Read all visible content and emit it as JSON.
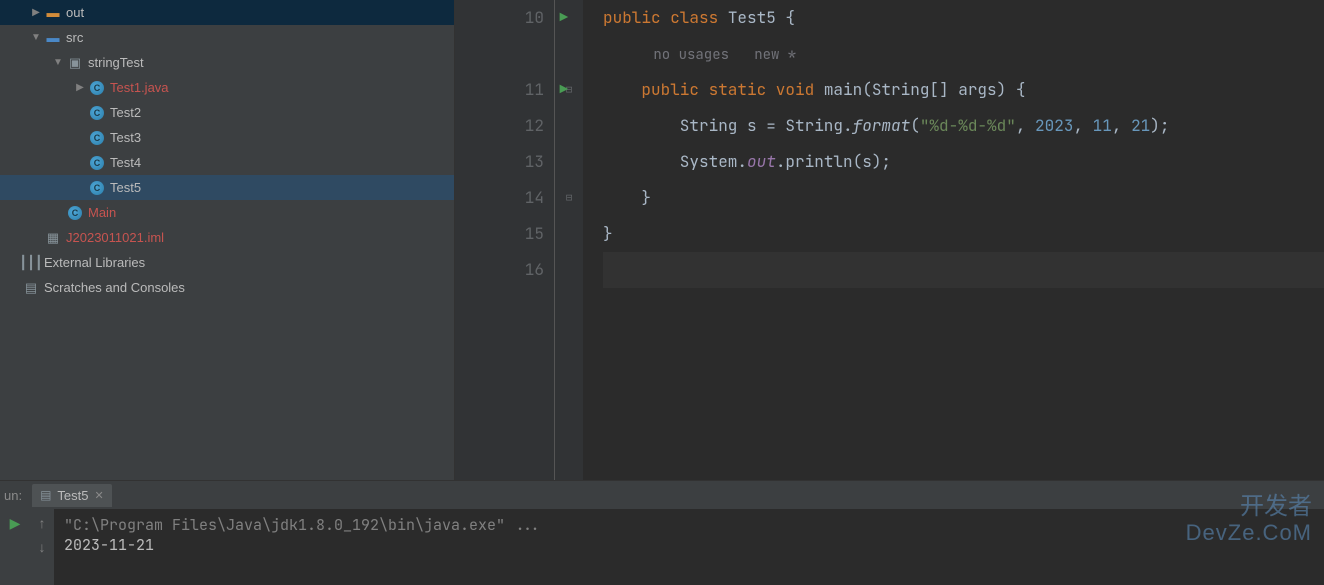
{
  "project_tree": {
    "items": [
      {
        "label": "out",
        "icon": "folder-orange",
        "indent": 0,
        "toggle": "▶",
        "interact": true
      },
      {
        "label": "src",
        "icon": "folder-blue",
        "indent": 0,
        "toggle": "▼",
        "interact": true
      },
      {
        "label": "stringTest",
        "icon": "folder-gray",
        "indent": 1,
        "toggle": "▼",
        "interact": true
      },
      {
        "label": "Test1.java",
        "icon": "java",
        "indent": 2,
        "toggle": "▶",
        "interact": true,
        "red": true
      },
      {
        "label": "Test2",
        "icon": "java",
        "indent": 2,
        "toggle": "",
        "interact": true
      },
      {
        "label": "Test3",
        "icon": "java",
        "indent": 2,
        "toggle": "",
        "interact": true
      },
      {
        "label": "Test4",
        "icon": "java",
        "indent": 2,
        "toggle": "",
        "interact": true
      },
      {
        "label": "Test5",
        "icon": "java",
        "indent": 2,
        "toggle": "",
        "interact": true,
        "selected": true
      },
      {
        "label": "Main",
        "icon": "java",
        "indent": 1,
        "toggle": "",
        "interact": true,
        "red": true
      },
      {
        "label": "J2023011021.iml",
        "icon": "iml",
        "indent": 0,
        "toggle": "",
        "interact": true,
        "red": true
      },
      {
        "label": "External Libraries",
        "icon": "lib",
        "indent": -1,
        "toggle": "",
        "interact": true
      },
      {
        "label": "Scratches and Consoles",
        "icon": "console",
        "indent": -1,
        "toggle": "",
        "interact": true
      }
    ]
  },
  "editor": {
    "gutter_start": 10,
    "lines": [
      {
        "n": 10,
        "run": true,
        "fold": "",
        "segments": [
          [
            "kw",
            "public class "
          ],
          [
            "",
            "Test5 {"
          ]
        ]
      },
      {
        "n": null,
        "hint_segments": [
          [
            "",
            "      no usages   new *"
          ]
        ]
      },
      {
        "n": 11,
        "run": true,
        "fold": "⊟",
        "segments": [
          [
            "",
            "    "
          ],
          [
            "kw",
            "public static void "
          ],
          [
            "",
            "main(String[] args) {"
          ]
        ]
      },
      {
        "n": 12,
        "segments": [
          [
            "",
            "        String s = String."
          ],
          [
            "method-italic",
            "format"
          ],
          [
            "",
            "("
          ],
          [
            "str",
            "\"%d-%d-%d\""
          ],
          [
            "",
            ", "
          ],
          [
            "num",
            "2023"
          ],
          [
            "",
            ", "
          ],
          [
            "num",
            "11"
          ],
          [
            "",
            ", "
          ],
          [
            "num",
            "21"
          ],
          [
            "",
            ");"
          ]
        ]
      },
      {
        "n": 13,
        "segments": [
          [
            "",
            "        System."
          ],
          [
            "static-field",
            "out"
          ],
          [
            "",
            ".println(s);"
          ]
        ]
      },
      {
        "n": 14,
        "fold": "⊟",
        "segments": [
          [
            "",
            "    }"
          ]
        ]
      },
      {
        "n": 15,
        "segments": [
          [
            "",
            "}"
          ]
        ]
      },
      {
        "n": 16,
        "caret": true,
        "segments": [
          [
            "",
            ""
          ]
        ]
      }
    ]
  },
  "run_panel": {
    "label": "un:",
    "tab_name": "Test5",
    "output_path": "\"C:\\Program Files\\Java\\jdk1.8.0_192\\bin\\java.exe\" ...",
    "output_result": "2023-11-21"
  },
  "watermark": {
    "line1": "开发者",
    "line2": "DevZe.CoM"
  }
}
